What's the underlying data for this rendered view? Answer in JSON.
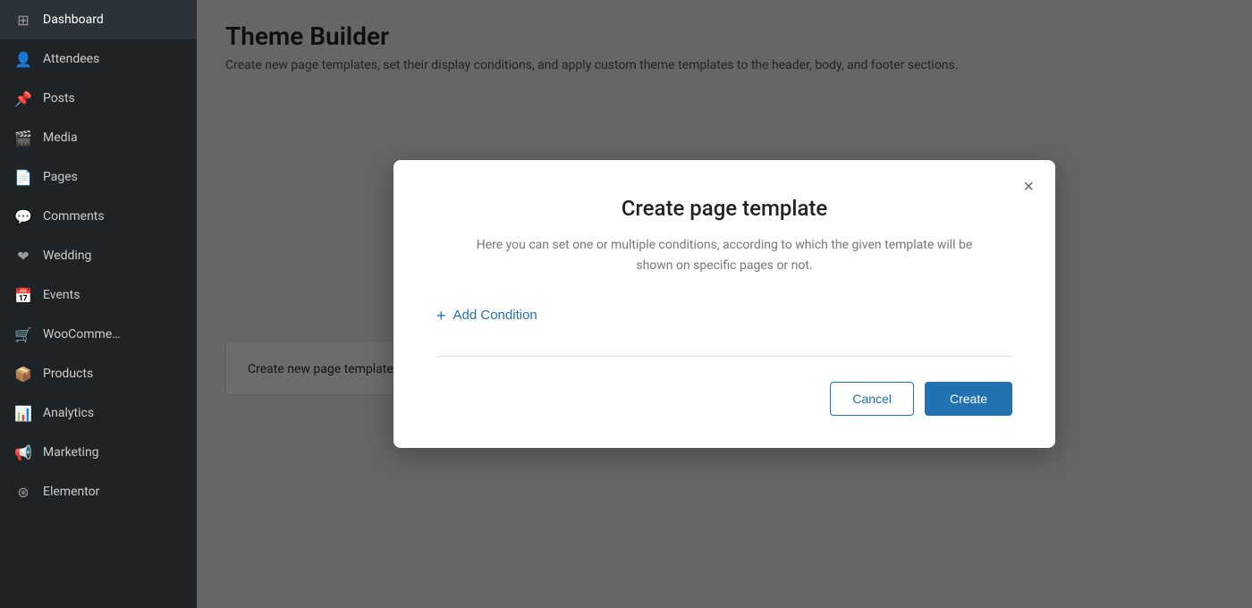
{
  "sidebar": {
    "items": [
      {
        "id": "dashboard",
        "label": "Dashboard",
        "icon": "⊞"
      },
      {
        "id": "attendees",
        "label": "Attendees",
        "icon": "👤"
      },
      {
        "id": "posts",
        "label": "Posts",
        "icon": "📌"
      },
      {
        "id": "media",
        "label": "Media",
        "icon": "🎬"
      },
      {
        "id": "pages",
        "label": "Pages",
        "icon": "📄"
      },
      {
        "id": "comments",
        "label": "Comments",
        "icon": "💬"
      },
      {
        "id": "wedding",
        "label": "Wedding",
        "icon": "❤"
      },
      {
        "id": "events",
        "label": "Events",
        "icon": "📅"
      },
      {
        "id": "woocommerce",
        "label": "WooComme…",
        "icon": "🛒"
      },
      {
        "id": "products",
        "label": "Products",
        "icon": "📦"
      },
      {
        "id": "analytics",
        "label": "Analytics",
        "icon": "📊"
      },
      {
        "id": "marketing",
        "label": "Marketing",
        "icon": "📢"
      },
      {
        "id": "elementor",
        "label": "Elementor",
        "icon": "⊛"
      }
    ]
  },
  "page": {
    "title": "Theme Builder",
    "subtitle": "Create new page templates, set their display conditions, and apply custom theme templates to the header, body, and footer sections.",
    "template_card_label": "Create new page template"
  },
  "modal": {
    "close_label": "×",
    "title": "Create page template",
    "description": "Here you can set one or multiple conditions, according to which the given template will be shown on specific pages or not.",
    "add_condition_label": "Add Condition",
    "cancel_label": "Cancel",
    "create_label": "Create"
  }
}
